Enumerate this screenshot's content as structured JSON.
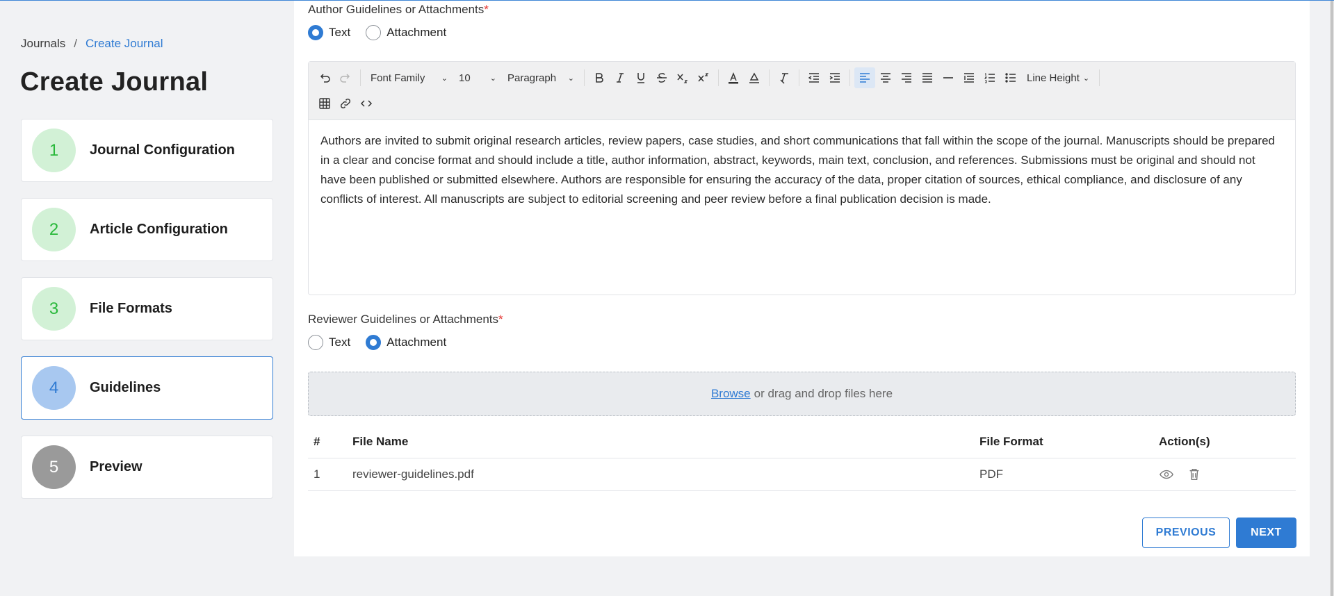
{
  "breadcrumb": {
    "root": "Journals",
    "separator": "/",
    "current": "Create Journal"
  },
  "page_title": "Create Journal",
  "steps": [
    {
      "num": "1",
      "label": "Journal Configuration",
      "state": "done"
    },
    {
      "num": "2",
      "label": "Article Configuration",
      "state": "done"
    },
    {
      "num": "3",
      "label": "File Formats",
      "state": "done"
    },
    {
      "num": "4",
      "label": "Guidelines",
      "state": "active"
    },
    {
      "num": "5",
      "label": "Preview",
      "state": "pending"
    }
  ],
  "author": {
    "label": "Author Guidelines or Attachments",
    "required": "*",
    "options": {
      "text": "Text",
      "attachment": "Attachment"
    },
    "selected": "text"
  },
  "toolbar": {
    "font_family": "Font Family",
    "font_size": "10",
    "block": "Paragraph",
    "line_height": "Line Height"
  },
  "editor_content": "Authors are invited to submit original research articles, review papers, case studies, and short communications that fall within the scope of the journal. Manuscripts should be prepared in a clear and concise format and should include a title, author information, abstract, keywords, main text, conclusion, and references. Submissions must be original and should not have been published or submitted elsewhere. Authors are responsible for ensuring the accuracy of the data, proper citation of sources, ethical compliance, and disclosure of any conflicts of interest. All manuscripts are subject to editorial screening and peer review before a final publication decision is made.",
  "reviewer": {
    "label": "Reviewer Guidelines or Attachments",
    "required": "*",
    "options": {
      "text": "Text",
      "attachment": "Attachment"
    },
    "selected": "attachment"
  },
  "dropzone": {
    "browse": "Browse",
    "text": "or drag and drop files here"
  },
  "files_table": {
    "headers": {
      "num": "#",
      "name": "File Name",
      "format": "File Format",
      "actions": "Action(s)"
    },
    "rows": [
      {
        "num": "1",
        "name": "reviewer-guidelines.pdf",
        "format": "PDF"
      }
    ]
  },
  "buttons": {
    "previous": "PREVIOUS",
    "next": "NEXT"
  },
  "colors": {
    "accent": "#2f7bd3",
    "done_circle": "#d2f1d6",
    "done_text": "#28b83a",
    "required": "#e53935"
  }
}
